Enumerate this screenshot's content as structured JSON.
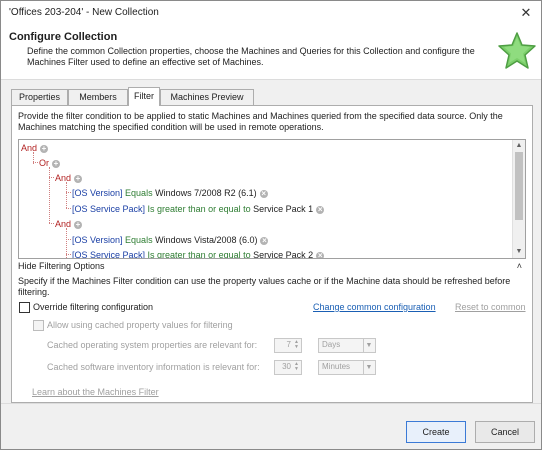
{
  "window": {
    "title": "'Offices 203-204' - New Collection",
    "close_glyph": "✕"
  },
  "header": {
    "title": "Configure Collection",
    "description": "Define the common Collection properties, choose the Machines and Queries for this Collection and configure the Machines Filter used to define an effective set of Machines.",
    "icon": "green-star-icon"
  },
  "tabs": [
    {
      "label": "Properties",
      "active": false
    },
    {
      "label": "Members",
      "active": false
    },
    {
      "label": "Filter",
      "active": true
    },
    {
      "label": "Machines Preview",
      "active": false
    }
  ],
  "filter": {
    "instruction": "Provide the filter condition to be applied to static Machines and Machines queried from the specified data source. Only the Machines matching the specified condition will be used in remote operations.",
    "tree": {
      "root": "And",
      "or": "Or",
      "group1": {
        "and": "And",
        "conditions": [
          {
            "attr": "[OS Version]",
            "op": "Equals",
            "value": "Windows 7/2008 R2 (6.1)"
          },
          {
            "attr": "[OS Service Pack]",
            "op": "Is greater than or equal to",
            "value": "Service Pack 1"
          }
        ]
      },
      "group2": {
        "and": "And",
        "conditions": [
          {
            "attr": "[OS Version]",
            "op": "Equals",
            "value": "Windows Vista/2008 (6.0)"
          },
          {
            "attr": "[OS Service Pack]",
            "op": "Is greater than or equal to",
            "value": "Service Pack 2"
          }
        ]
      }
    },
    "colors": {
      "and_or": "#b22222",
      "attribute": "#1a3fa5",
      "operator": "#2e7d32"
    }
  },
  "options": {
    "section_title": "Hide Filtering Options",
    "description": "Specify if the Machines Filter condition can use the property values cache or if the Machine data should be refreshed before filtering.",
    "override_label": "Override filtering configuration",
    "change_link": "Change common configuration",
    "reset_link": "Reset to common",
    "allow_cache_label": "Allow using cached property values for filtering",
    "os_props_label": "Cached operating system properties are relevant for:",
    "os_props_value": "7",
    "os_props_unit": "Days",
    "sw_inv_label": "Cached software inventory information is relevant for:",
    "sw_inv_value": "30",
    "sw_inv_unit": "Minutes",
    "learn_link": "Learn about the Machines Filter"
  },
  "footer": {
    "create_label": "Create",
    "cancel_label": "Cancel"
  }
}
